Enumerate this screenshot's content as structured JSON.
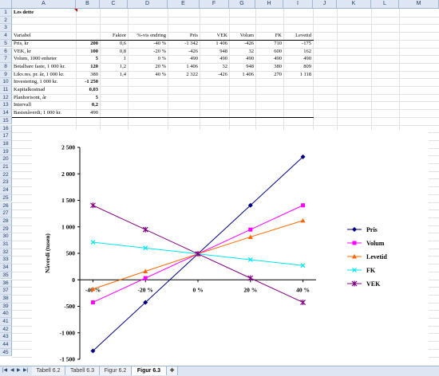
{
  "columns": [
    "A",
    "B",
    "C",
    "D",
    "E",
    "F",
    "G",
    "H",
    "I",
    "J",
    "K",
    "L",
    "M"
  ],
  "rows": [
    "1",
    "2",
    "3",
    "4",
    "5",
    "6",
    "7",
    "8",
    "9",
    "10",
    "11",
    "12",
    "13",
    "14",
    "15",
    "16",
    "17",
    "18",
    "19",
    "20",
    "21",
    "22",
    "23",
    "24",
    "25",
    "26",
    "27",
    "28",
    "29",
    "30",
    "31",
    "32",
    "33",
    "34",
    "35",
    "36",
    "37",
    "38",
    "39",
    "40",
    "41",
    "42",
    "43",
    "44",
    "45"
  ],
  "cells": {
    "a1": "Les dette",
    "headers": [
      "Variabel",
      "Faktor",
      "%-vis endring",
      "Pris",
      "VEK",
      "Volum",
      "FK",
      "Levetid"
    ],
    "table": [
      [
        "Pris, kr",
        "200",
        "0,6",
        "-40 %",
        "-1 342",
        "1 406",
        "-426",
        "710",
        "-175"
      ],
      [
        "VEK, kr",
        "100",
        "0,8",
        "-20 %",
        "-426",
        "948",
        "32",
        "600",
        "162"
      ],
      [
        "Volum, 1000 enheter",
        "5",
        "1",
        "0 %",
        "490",
        "490",
        "490",
        "490",
        "490"
      ],
      [
        "Betalbare faste, 1 000 kr.",
        "120",
        "1,2",
        "20 %",
        "1 406",
        "32",
        "948",
        "380",
        "809"
      ],
      [
        "Likv.res. pr. år, 1 000 kr.",
        "380",
        "1,4",
        "40 %",
        "2 322",
        "-426",
        "1 406",
        "270",
        "1 118"
      ]
    ],
    "extra": [
      [
        "Investering, 1 000 kr.",
        "-1 250"
      ],
      [
        "Kapitalkostnad",
        "0,03"
      ],
      [
        "Planhorisont, år",
        "5"
      ],
      [
        "Intervall",
        "0,2"
      ],
      [
        "Basisnåverdi; 1 000 kr.",
        "490"
      ]
    ]
  },
  "chart_data": {
    "type": "line",
    "categories": [
      "-40 %",
      "-20 %",
      "0 %",
      "20 %",
      "40 %"
    ],
    "x": [
      -40,
      -20,
      0,
      20,
      40
    ],
    "ylabel": "Nåverdi (tusen)",
    "ylim": [
      -1500,
      2500
    ],
    "yticks": [
      "2 500",
      "2 000",
      "1 500",
      "1 000",
      "500",
      "0",
      "-500",
      "-1 000",
      "-1 500"
    ],
    "series": [
      {
        "name": "Pris",
        "color": "#000080",
        "marker": "diamond",
        "values": [
          -1342,
          -426,
          490,
          1406,
          2322
        ]
      },
      {
        "name": "Volum",
        "color": "#ff00ff",
        "marker": "square",
        "values": [
          -426,
          32,
          490,
          948,
          1406
        ]
      },
      {
        "name": "Levetid",
        "color": "#ff6600",
        "marker": "triangle",
        "values": [
          -175,
          162,
          490,
          809,
          1118
        ]
      },
      {
        "name": "FK",
        "color": "#00e5ee",
        "marker": "x",
        "values": [
          710,
          600,
          490,
          380,
          270
        ]
      },
      {
        "name": "VEK",
        "color": "#800080",
        "marker": "star",
        "values": [
          1406,
          948,
          490,
          32,
          -426
        ]
      }
    ],
    "legend": "right"
  },
  "tabs": [
    "Tabell 6.2",
    "Tabell 6.3",
    "Figur 6.2",
    "Figur 6.3"
  ],
  "active_tab": "Figur 6.3"
}
